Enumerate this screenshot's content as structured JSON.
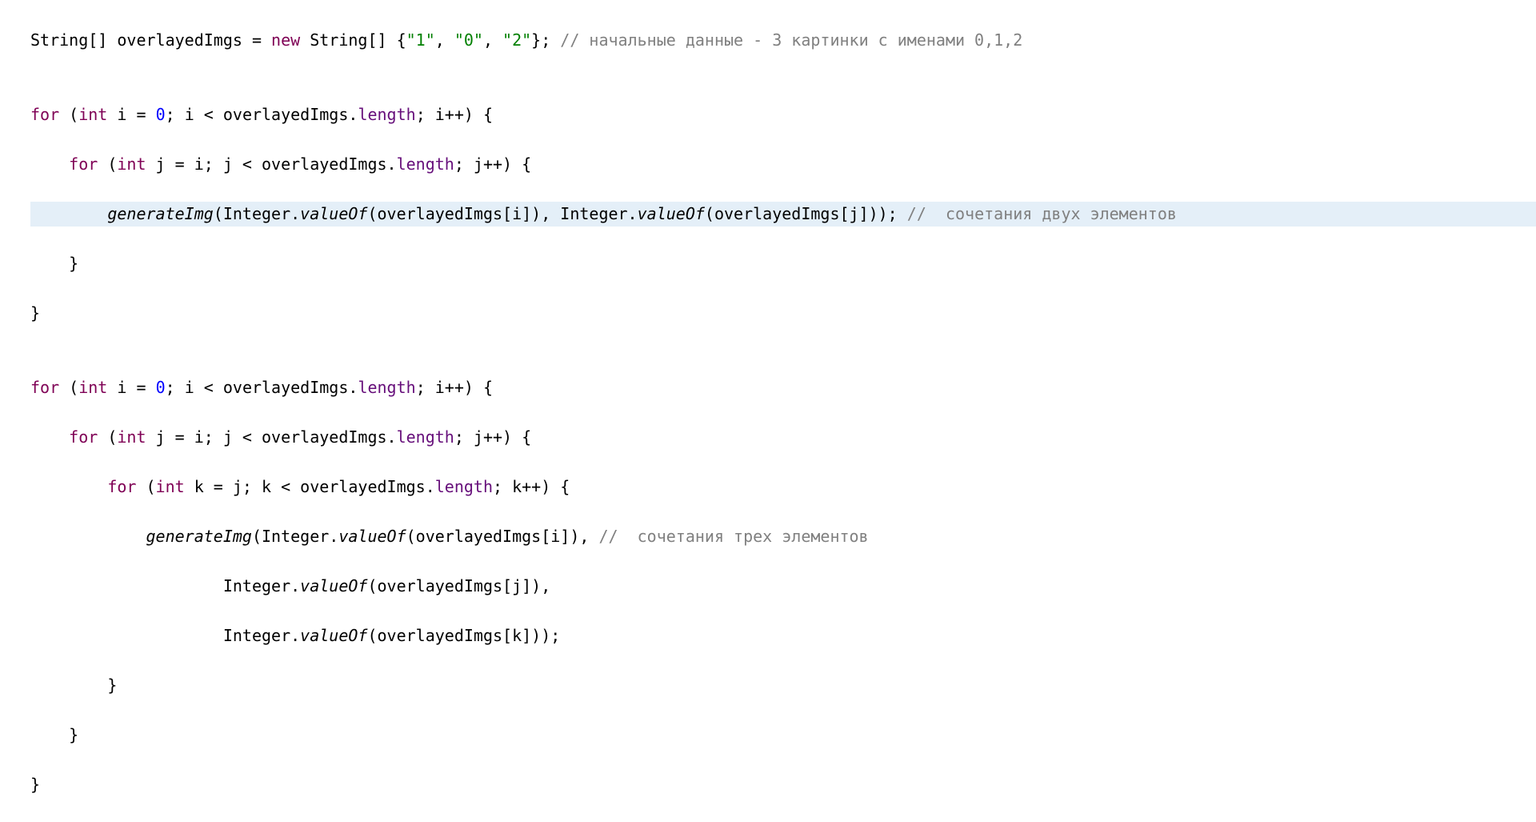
{
  "code": {
    "l1": {
      "t1": "String[] overlayedImgs = ",
      "kw_new": "new",
      "t2": " String[] {",
      "s1": "\"1\"",
      "t3": ", ",
      "s2": "\"0\"",
      "t4": ", ",
      "s3": "\"2\"",
      "t5": "}; ",
      "c1": "// начальные данные - 3 картинки с именами 0,1,2"
    },
    "l2": "",
    "l3": {
      "kw_for": "for",
      "t1": " (",
      "kw_int": "int",
      "t2": " i = ",
      "n0": "0",
      "t3": "; i < overlayedImgs.",
      "fld": "length",
      "t4": "; i++) {"
    },
    "l4": {
      "indent": "    ",
      "kw_for": "for",
      "t1": " (",
      "kw_int": "int",
      "t2": " j = i; j < overlayedImgs.",
      "fld": "length",
      "t3": "; j++) {"
    },
    "l5": {
      "indent": "        ",
      "m1": "generateImg",
      "t1": "(Integer.",
      "m2": "valueOf",
      "t2": "(overlayedImgs[i]), Integer.",
      "m3": "valueOf",
      "t3": "(overlayedImgs[j])); ",
      "c1": "//  сочетания двух элементов"
    },
    "l6": "    }",
    "l7": "}",
    "l8": "",
    "l9": {
      "kw_for": "for",
      "t1": " (",
      "kw_int": "int",
      "t2": " i = ",
      "n0": "0",
      "t3": "; i < overlayedImgs.",
      "fld": "length",
      "t4": "; i++) {"
    },
    "l10": {
      "indent": "    ",
      "kw_for": "for",
      "t1": " (",
      "kw_int": "int",
      "t2": " j = i; j < overlayedImgs.",
      "fld": "length",
      "t3": "; j++) {"
    },
    "l11": {
      "indent": "        ",
      "kw_for": "for",
      "t1": " (",
      "kw_int": "int",
      "t2": " k = j; k < overlayedImgs.",
      "fld": "length",
      "t3": "; k++) {"
    },
    "l12": {
      "indent": "            ",
      "m1": "generateImg",
      "t1": "(Integer.",
      "m2": "valueOf",
      "t2": "(overlayedImgs[i]), ",
      "c1": "//  сочетания трех элементов"
    },
    "l13": {
      "indent": "                    ",
      "t1": "Integer.",
      "m1": "valueOf",
      "t2": "(overlayedImgs[j]),"
    },
    "l14": {
      "indent": "                    ",
      "t1": "Integer.",
      "m1": "valueOf",
      "t2": "(overlayedImgs[k]));"
    },
    "l15": "        }",
    "l16": "    }",
    "l17": "}"
  }
}
